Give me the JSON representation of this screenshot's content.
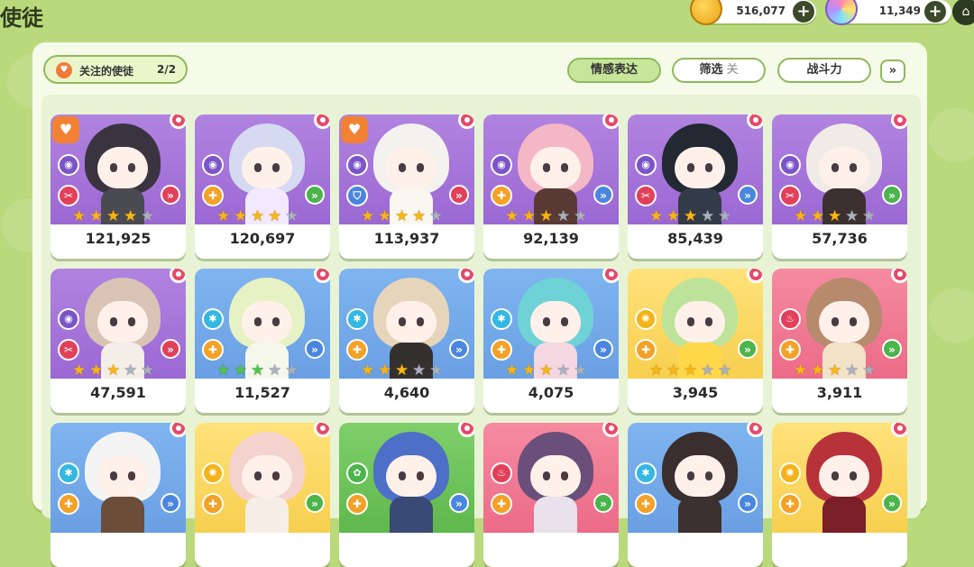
{
  "header": {
    "title": "使徒",
    "coins": "516,077",
    "gems": "11,349",
    "plus_label": "+",
    "home_icon": "home-icon"
  },
  "toolbar": {
    "fav_label": "关注的使徒",
    "fav_count": "2/2",
    "emote_label": "情感表达",
    "filter_label": "筛选",
    "filter_state": "关",
    "power_label": "战斗力",
    "expand_label": "»"
  },
  "cards": [
    {
      "power": "121,925",
      "bg": "purple",
      "hair": "#3a3440",
      "body": "#4a4a52",
      "gem": "purple",
      "role": "red",
      "role_glyph": "✂",
      "arrow": "red",
      "stars_filled": 4,
      "star_color": "gold",
      "fav": true
    },
    {
      "power": "120,697",
      "bg": "purple",
      "hair": "#d6d9f2",
      "body": "#f3e9ff",
      "gem": "purple",
      "role": "orange",
      "role_glyph": "✚",
      "arrow": "green",
      "stars_filled": 4,
      "star_color": "gold",
      "fav": false
    },
    {
      "power": "113,937",
      "bg": "purple",
      "hair": "#f4f2ee",
      "body": "#faf7f0",
      "gem": "purple",
      "role": "blue",
      "role_glyph": "⛉",
      "arrow": "red",
      "stars_filled": 4,
      "star_color": "gold",
      "fav": true
    },
    {
      "power": "92,139",
      "bg": "purple",
      "hair": "#f4b7c6",
      "body": "#5a3a34",
      "gem": "purple",
      "role": "orange",
      "role_glyph": "✚",
      "arrow": "blue",
      "stars_filled": 3,
      "star_color": "gold",
      "fav": false
    },
    {
      "power": "85,439",
      "bg": "purple",
      "hair": "#222933",
      "body": "#343b48",
      "gem": "purple",
      "role": "red",
      "role_glyph": "✂",
      "arrow": "blue",
      "stars_filled": 3,
      "star_color": "gold",
      "fav": false
    },
    {
      "power": "57,736",
      "bg": "purple",
      "hair": "#f1ebe7",
      "body": "#3c3030",
      "gem": "purple",
      "role": "red",
      "role_glyph": "✂",
      "arrow": "green",
      "stars_filled": 3,
      "star_color": "gold",
      "fav": false
    },
    {
      "power": "47,591",
      "bg": "purple",
      "hair": "#d9c3b5",
      "body": "#f3eee8",
      "gem": "purple",
      "role": "red",
      "role_glyph": "✂",
      "arrow": "red",
      "stars_filled": 3,
      "star_color": "gold",
      "fav": false
    },
    {
      "power": "11,527",
      "bg": "blue",
      "hair": "#e6f1c4",
      "body": "#f5f7ea",
      "gem": "cyan",
      "role": "orange",
      "role_glyph": "✚",
      "arrow": "blue",
      "stars_filled": 3,
      "star_color": "green",
      "fav": false
    },
    {
      "power": "4,640",
      "bg": "blue",
      "hair": "#e7d5bb",
      "body": "#34302e",
      "gem": "cyan",
      "role": "orange",
      "role_glyph": "✚",
      "arrow": "blue",
      "stars_filled": 3,
      "star_color": "gold",
      "fav": false
    },
    {
      "power": "4,075",
      "bg": "blue",
      "hair": "#6fd2d6",
      "body": "#f5d7e2",
      "gem": "cyan",
      "role": "orange",
      "role_glyph": "✚",
      "arrow": "blue",
      "stars_filled": 3,
      "star_color": "gold",
      "fav": false
    },
    {
      "power": "3,945",
      "bg": "yellow",
      "hair": "#bde39a",
      "body": "#ffd84a",
      "gem": "yellow",
      "role": "orange",
      "role_glyph": "✚",
      "arrow": "green",
      "stars_filled": 3,
      "star_color": "gold",
      "fav": false
    },
    {
      "power": "3,911",
      "bg": "red",
      "hair": "#b78a6e",
      "body": "#f2e2c8",
      "gem": "red",
      "role": "orange",
      "role_glyph": "✚",
      "arrow": "green",
      "stars_filled": 3,
      "star_color": "gold",
      "fav": false
    },
    {
      "power": "",
      "bg": "blue",
      "hair": "#f4f4f4",
      "body": "#6b4d3a",
      "gem": "cyan",
      "role": "orange",
      "role_glyph": "✚",
      "arrow": "blue",
      "stars_filled": 0,
      "star_color": "gold",
      "fav": false
    },
    {
      "power": "",
      "bg": "yellow",
      "hair": "#f4d2ce",
      "body": "#f6eee6",
      "gem": "yellow",
      "role": "orange",
      "role_glyph": "✚",
      "arrow": "green",
      "stars_filled": 0,
      "star_color": "gold",
      "fav": false
    },
    {
      "power": "",
      "bg": "green",
      "hair": "#4d6fc7",
      "body": "#3a4a76",
      "gem": "green",
      "role": "orange",
      "role_glyph": "✚",
      "arrow": "blue",
      "stars_filled": 0,
      "star_color": "gold",
      "fav": false
    },
    {
      "power": "",
      "bg": "red",
      "hair": "#6a4f7a",
      "body": "#e9e2ec",
      "gem": "red",
      "role": "orange",
      "role_glyph": "✚",
      "arrow": "green",
      "stars_filled": 0,
      "star_color": "gold",
      "fav": false
    },
    {
      "power": "",
      "bg": "blue",
      "hair": "#3a2e2e",
      "body": "#3c3030",
      "gem": "cyan",
      "role": "orange",
      "role_glyph": "✚",
      "arrow": "blue",
      "stars_filled": 0,
      "star_color": "gold",
      "fav": false
    },
    {
      "power": "",
      "bg": "yellow",
      "hair": "#b8323a",
      "body": "#7a1f27",
      "gem": "yellow",
      "role": "orange",
      "role_glyph": "✚",
      "arrow": "green",
      "stars_filled": 0,
      "star_color": "gold",
      "fav": false
    }
  ],
  "palette": {
    "purple": "#7b55c8",
    "red": "#e2405a",
    "orange": "#f3a227",
    "blue": "#4a86e0",
    "green": "#4bb44a",
    "cyan": "#34b7e0",
    "yellow": "#f2b41a"
  }
}
